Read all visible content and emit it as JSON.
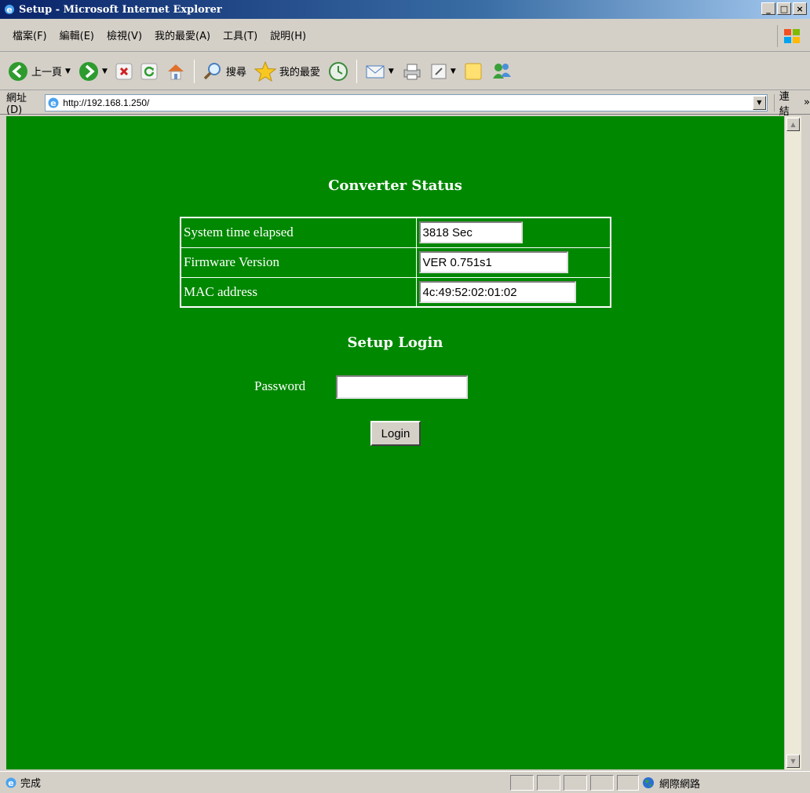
{
  "window": {
    "title": "Setup - Microsoft Internet Explorer",
    "minimize": "_",
    "maximize": "□",
    "close": "×"
  },
  "menu": {
    "items": [
      "檔案(F)",
      "編輯(E)",
      "檢視(V)",
      "我的最愛(A)",
      "工具(T)",
      "說明(H)"
    ]
  },
  "toolbar": {
    "back_label": "上一頁",
    "search_label": "搜尋",
    "favorites_label": "我的最愛"
  },
  "address": {
    "label": "網址(D)",
    "url": "http://192.168.1.250/",
    "links_label": "連結"
  },
  "page": {
    "status_heading": "Converter Status",
    "rows": [
      {
        "label": "System time elapsed",
        "value": "3818 Sec"
      },
      {
        "label": "Firmware Version",
        "value": "VER 0.751s1"
      },
      {
        "label": "MAC address",
        "value": "4c:49:52:02:01:02"
      }
    ],
    "login_heading": "Setup Login",
    "password_label": "Password",
    "password_value": "",
    "login_button": "Login",
    "background_color": "#008800"
  },
  "statusbar": {
    "text": "完成",
    "zone": "網際網路"
  }
}
